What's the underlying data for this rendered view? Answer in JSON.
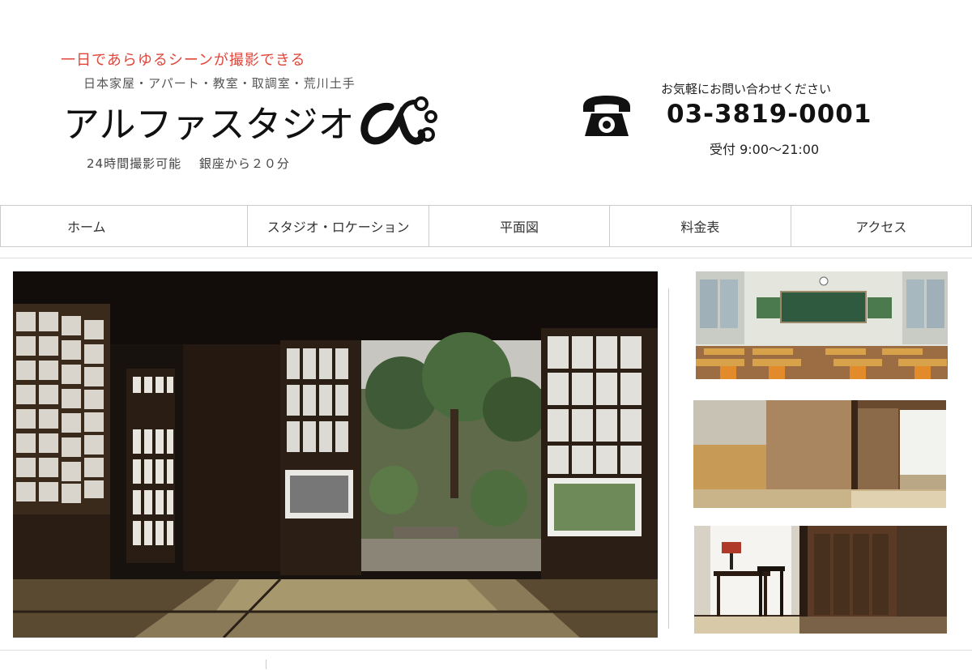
{
  "header": {
    "tagline": "一日であらゆるシーンが撮影できる",
    "subline": "日本家屋・アパート・教室・取調室・荒川土手",
    "logo_text": "アルファスタジオ",
    "hours_line": "24時間撮影可能　 銀座から２０分"
  },
  "contact": {
    "label": "お気軽にお問い合わせください",
    "phone": "03-3819-0001",
    "reception": "受付 9:00〜21:00",
    "icon": "telephone-icon"
  },
  "nav": {
    "items": [
      {
        "label": "ホーム"
      },
      {
        "label": "スタジオ・ロケーション"
      },
      {
        "label": "平面図"
      },
      {
        "label": "料金表"
      },
      {
        "label": "アクセス"
      }
    ]
  },
  "colors": {
    "tagline": "#e2453a",
    "text": "#333333",
    "border": "#cccccc"
  }
}
